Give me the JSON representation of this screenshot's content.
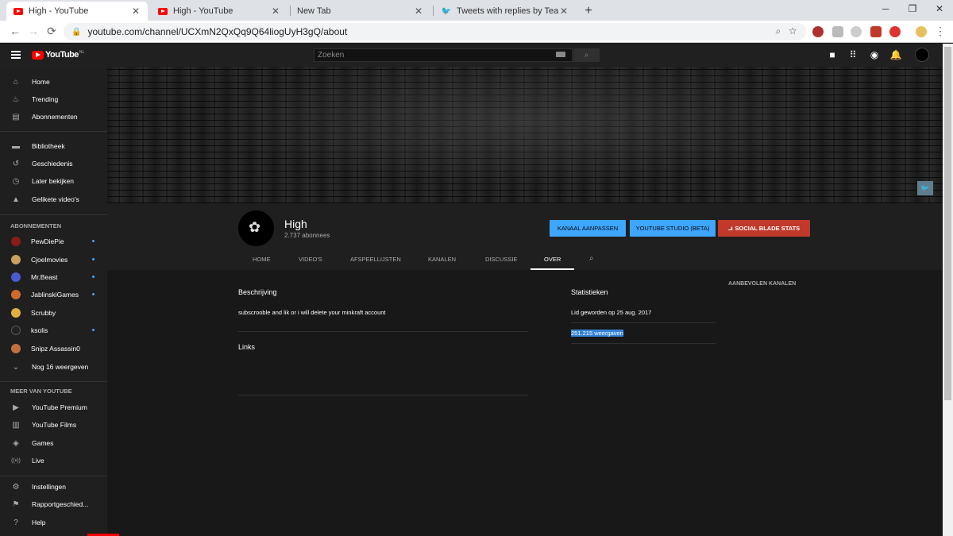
{
  "browser": {
    "tabs": [
      {
        "title": "High - YouTube",
        "favicon": "youtube-icon",
        "active": true
      },
      {
        "title": "High - YouTube",
        "favicon": "youtube-icon",
        "active": false
      },
      {
        "title": "New Tab",
        "favicon": "",
        "active": false
      },
      {
        "title": "Tweets with replies by TeamYouT",
        "favicon": "twitter-icon",
        "active": false
      }
    ],
    "new_tab": "+",
    "window_controls": {
      "minimize": "─",
      "restore": "❐",
      "close": "✕"
    },
    "url": "youtube.com/channel/UCXmN2QxQq9Q64liogUyH3gQ/about",
    "nav": {
      "back": "←",
      "forward": "→",
      "reload": "⟳"
    }
  },
  "masthead": {
    "logo_text": "YouTube",
    "region": "NL",
    "search_placeholder": "Zoeken",
    "search_icon": "⌕",
    "icons": [
      "video-camera-icon",
      "apps-icon",
      "messages-icon",
      "bell-icon"
    ]
  },
  "sidebar": {
    "main": [
      {
        "label": "Home",
        "icon": "home-icon",
        "glyph": "⌂"
      },
      {
        "label": "Trending",
        "icon": "flame-icon",
        "glyph": "♨"
      },
      {
        "label": "Abonnementen",
        "icon": "subscriptions-icon",
        "glyph": "▤"
      }
    ],
    "library": [
      {
        "label": "Bibliotheek",
        "icon": "folder-icon",
        "glyph": "▬"
      },
      {
        "label": "Geschiedenis",
        "icon": "history-icon",
        "glyph": "↺"
      },
      {
        "label": "Later bekijken",
        "icon": "clock-icon",
        "glyph": "◷"
      },
      {
        "label": "Gelikete video's",
        "icon": "thumb-up-icon",
        "glyph": "👍"
      }
    ],
    "subs_heading": "ABONNEMENTEN",
    "subscriptions": [
      {
        "label": "PewDiePie",
        "color": "#8b1a1a",
        "dot": true
      },
      {
        "label": "Cjoelmovies",
        "color": "#c8a060",
        "dot": true
      },
      {
        "label": "Mr.Beast",
        "color": "#4a5ad0",
        "dot": true
      },
      {
        "label": "JablinskiGames",
        "color": "#d06a2a",
        "dot": true
      },
      {
        "label": "Scrubby",
        "color": "#e0b040",
        "dot": false
      },
      {
        "label": "ksolis",
        "color": "#222222",
        "dot": true
      },
      {
        "label": "Snipz Assassin0",
        "color": "#c07040",
        "dot": false
      }
    ],
    "show_more": {
      "label": "Nog 16 weergeven",
      "glyph": "⌄"
    },
    "more_heading": "MEER VAN YOUTUBE",
    "more": [
      {
        "label": "YouTube Premium",
        "icon": "youtube-premium-icon",
        "glyph": "▶"
      },
      {
        "label": "YouTube Films",
        "icon": "film-icon",
        "glyph": "▥"
      },
      {
        "label": "Games",
        "icon": "gamepad-icon",
        "glyph": "◈"
      },
      {
        "label": "Live",
        "icon": "live-icon",
        "glyph": "((•))"
      }
    ],
    "footer": [
      {
        "label": "Instellingen",
        "icon": "gear-icon",
        "glyph": "⚙"
      },
      {
        "label": "Rapportgeschied...",
        "icon": "flag-icon",
        "glyph": "⚑"
      },
      {
        "label": "Help",
        "icon": "help-icon",
        "glyph": "?"
      }
    ]
  },
  "channel": {
    "name": "High",
    "subscribers": "2.737 abonnees",
    "buttons": {
      "customize": "KANAAL AANPASSEN",
      "studio": "YOUTUBE STUDIO (BETA)",
      "social_blade": "SOCIAL BLADE STATS"
    },
    "tabs": [
      "HOME",
      "VIDEO'S",
      "AFSPEELLIJSTEN",
      "KANALEN",
      "DISCUSSIE",
      "OVER"
    ],
    "active_tab": "OVER"
  },
  "about": {
    "description_title": "Beschrijving",
    "description": "subscrooble and lik or i will delete your minkraft account",
    "links_title": "Links",
    "stats_title": "Statistieken",
    "joined": "Lid geworden op 25 aug. 2017",
    "views": "251.215 weergaven",
    "featured_title": "AANBEVOLEN KANALEN"
  },
  "colors": {
    "accent_blue": "#3ea6ff",
    "social_blade_red": "#c0392b",
    "yt_red": "#ff0000",
    "selection": "#3483d6"
  }
}
